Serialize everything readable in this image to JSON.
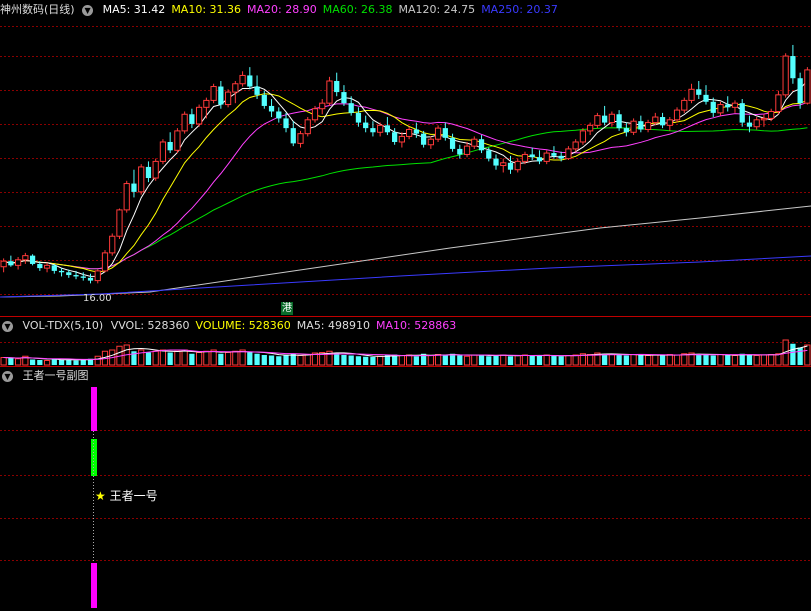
{
  "main": {
    "title": "神州数码(日线)",
    "ma": [
      {
        "label": "MA5: 31.42",
        "color": "#ffffff"
      },
      {
        "label": "MA10: 31.36",
        "color": "#ffff00"
      },
      {
        "label": "MA20: 28.90",
        "color": "#ff40ff"
      },
      {
        "label": "MA60: 26.38",
        "color": "#00e000"
      },
      {
        "label": "MA120: 24.75",
        "color": "#c8c8c8"
      },
      {
        "label": "MA250: 20.37",
        "color": "#3a3aff"
      }
    ],
    "low_label": "16.00",
    "hk_tag": "港"
  },
  "vol": {
    "title": "VOL-TDX(5,10)",
    "items": [
      {
        "label": "VVOL: 528360",
        "color": "#dddddd"
      },
      {
        "label": "VOLUME: 528360",
        "color": "#ffff00"
      },
      {
        "label": "MA5: 498910",
        "color": "#dddddd"
      },
      {
        "label": "MA10: 528863",
        "color": "#ff40ff"
      }
    ]
  },
  "sub": {
    "title": "王者一号副图",
    "signal_label": "王者一号",
    "star": "★"
  },
  "colors": {
    "up": "#ff3a3a",
    "down": "#54ffff",
    "grid": "#8a0000",
    "magenta": "#ff00ff",
    "green": "#00ff00"
  },
  "chart_data": {
    "type": "candlestick",
    "candles": [
      [
        17.2,
        17.8,
        16.8,
        17.6
      ],
      [
        17.6,
        18.0,
        17.2,
        17.3
      ],
      [
        17.3,
        17.9,
        17.0,
        17.7
      ],
      [
        17.7,
        18.2,
        17.4,
        18.0
      ],
      [
        18.0,
        18.1,
        17.3,
        17.4
      ],
      [
        17.4,
        17.6,
        16.9,
        17.1
      ],
      [
        17.1,
        17.5,
        16.8,
        17.3
      ],
      [
        17.3,
        17.4,
        16.7,
        16.9
      ],
      [
        16.9,
        17.1,
        16.5,
        16.8
      ],
      [
        16.8,
        17.0,
        16.4,
        16.6
      ],
      [
        16.6,
        16.9,
        16.3,
        16.5
      ],
      [
        16.5,
        16.8,
        16.2,
        16.4
      ],
      [
        16.4,
        16.7,
        16.0,
        16.2
      ],
      [
        16.2,
        17.0,
        16.0,
        16.9
      ],
      [
        16.9,
        18.4,
        16.8,
        18.2
      ],
      [
        18.2,
        19.6,
        18.0,
        19.4
      ],
      [
        19.4,
        21.4,
        19.2,
        21.3
      ],
      [
        21.3,
        23.4,
        21.1,
        23.2
      ],
      [
        23.2,
        24.2,
        22.2,
        22.6
      ],
      [
        22.6,
        24.6,
        22.4,
        24.4
      ],
      [
        24.4,
        24.8,
        23.3,
        23.6
      ],
      [
        23.6,
        25.0,
        23.4,
        24.8
      ],
      [
        24.8,
        26.4,
        24.6,
        26.2
      ],
      [
        26.2,
        26.9,
        25.4,
        25.6
      ],
      [
        25.6,
        27.2,
        25.4,
        27.0
      ],
      [
        27.0,
        28.4,
        26.8,
        28.2
      ],
      [
        28.2,
        28.6,
        27.2,
        27.5
      ],
      [
        27.5,
        28.9,
        27.3,
        28.7
      ],
      [
        28.7,
        29.4,
        27.9,
        29.2
      ],
      [
        29.2,
        30.4,
        29.0,
        30.2
      ],
      [
        30.2,
        30.6,
        28.6,
        28.9
      ],
      [
        28.9,
        30.0,
        28.7,
        29.8
      ],
      [
        29.8,
        30.6,
        29.0,
        30.4
      ],
      [
        30.4,
        31.3,
        30.2,
        31.0
      ],
      [
        31.0,
        31.6,
        30.0,
        30.2
      ],
      [
        30.2,
        31.0,
        29.3,
        29.6
      ],
      [
        29.6,
        29.9,
        28.6,
        28.8
      ],
      [
        28.8,
        29.3,
        28.0,
        28.4
      ],
      [
        28.4,
        28.7,
        27.6,
        27.9
      ],
      [
        27.9,
        28.3,
        26.9,
        27.2
      ],
      [
        27.2,
        27.7,
        25.9,
        26.1
      ],
      [
        26.1,
        27.0,
        25.8,
        26.8
      ],
      [
        26.8,
        28.0,
        26.6,
        27.8
      ],
      [
        27.8,
        28.8,
        27.6,
        28.6
      ],
      [
        28.6,
        29.3,
        28.2,
        29.0
      ],
      [
        29.0,
        30.9,
        28.8,
        30.6
      ],
      [
        30.6,
        31.2,
        29.5,
        29.8
      ],
      [
        29.8,
        30.3,
        28.8,
        29.0
      ],
      [
        29.0,
        29.5,
        28.1,
        28.3
      ],
      [
        28.3,
        28.7,
        27.3,
        27.6
      ],
      [
        27.6,
        28.1,
        26.9,
        27.2
      ],
      [
        27.2,
        27.7,
        26.6,
        26.9
      ],
      [
        26.9,
        27.6,
        26.6,
        27.4
      ],
      [
        27.4,
        28.0,
        26.7,
        26.9
      ],
      [
        26.9,
        27.2,
        26.0,
        26.2
      ],
      [
        26.2,
        26.9,
        25.8,
        26.6
      ],
      [
        26.6,
        27.3,
        26.4,
        27.1
      ],
      [
        27.1,
        27.6,
        26.5,
        26.8
      ],
      [
        26.8,
        27.0,
        25.8,
        26.0
      ],
      [
        26.0,
        26.6,
        25.7,
        26.4
      ],
      [
        26.4,
        27.4,
        26.2,
        27.2
      ],
      [
        27.2,
        27.6,
        26.3,
        26.5
      ],
      [
        26.5,
        26.8,
        25.5,
        25.7
      ],
      [
        25.7,
        26.0,
        25.0,
        25.3
      ],
      [
        25.3,
        26.2,
        25.1,
        25.9
      ],
      [
        25.9,
        26.6,
        25.7,
        26.4
      ],
      [
        26.4,
        26.7,
        25.4,
        25.6
      ],
      [
        25.6,
        25.8,
        24.8,
        25.0
      ],
      [
        25.0,
        25.3,
        24.2,
        24.5
      ],
      [
        24.5,
        25.0,
        24.0,
        24.7
      ],
      [
        24.7,
        25.2,
        23.9,
        24.2
      ],
      [
        24.2,
        25.0,
        24.0,
        24.8
      ],
      [
        24.8,
        25.5,
        24.6,
        25.3
      ],
      [
        25.3,
        25.8,
        24.9,
        25.1
      ],
      [
        25.1,
        25.6,
        24.6,
        24.8
      ],
      [
        24.8,
        25.6,
        24.6,
        25.4
      ],
      [
        25.4,
        25.9,
        25.0,
        25.2
      ],
      [
        25.2,
        25.5,
        24.8,
        25.0
      ],
      [
        25.0,
        25.9,
        24.9,
        25.7
      ],
      [
        25.7,
        26.4,
        25.5,
        26.2
      ],
      [
        26.2,
        27.2,
        26.0,
        27.0
      ],
      [
        27.0,
        27.6,
        26.7,
        27.4
      ],
      [
        27.4,
        28.3,
        27.2,
        28.1
      ],
      [
        28.1,
        28.8,
        27.4,
        27.6
      ],
      [
        27.6,
        28.4,
        27.3,
        28.2
      ],
      [
        28.2,
        28.5,
        27.0,
        27.2
      ],
      [
        27.2,
        27.6,
        26.6,
        26.9
      ],
      [
        26.9,
        27.9,
        26.7,
        27.7
      ],
      [
        27.7,
        28.1,
        26.9,
        27.1
      ],
      [
        27.1,
        27.8,
        26.9,
        27.6
      ],
      [
        27.6,
        28.3,
        27.4,
        28.0
      ],
      [
        28.0,
        28.3,
        27.2,
        27.4
      ],
      [
        27.4,
        28.0,
        27.0,
        27.8
      ],
      [
        27.8,
        28.7,
        27.6,
        28.5
      ],
      [
        28.5,
        29.4,
        28.3,
        29.2
      ],
      [
        29.2,
        30.4,
        29.0,
        30.0
      ],
      [
        30.0,
        30.6,
        29.3,
        29.6
      ],
      [
        29.6,
        30.3,
        28.9,
        29.1
      ],
      [
        29.1,
        29.4,
        28.0,
        28.3
      ],
      [
        28.3,
        29.1,
        28.1,
        28.9
      ],
      [
        28.9,
        29.5,
        28.4,
        28.7
      ],
      [
        28.7,
        29.2,
        28.3,
        29.0
      ],
      [
        29.0,
        29.3,
        27.3,
        27.6
      ],
      [
        27.6,
        28.1,
        26.9,
        27.3
      ],
      [
        27.3,
        28.0,
        27.1,
        27.8
      ],
      [
        27.8,
        28.2,
        27.3,
        27.9
      ],
      [
        27.9,
        28.6,
        27.7,
        28.4
      ],
      [
        28.4,
        29.9,
        28.2,
        29.6
      ],
      [
        29.6,
        32.6,
        29.4,
        32.4
      ],
      [
        32.4,
        33.2,
        30.4,
        30.8
      ],
      [
        30.8,
        31.2,
        28.6,
        29.0
      ],
      [
        29.0,
        31.6,
        28.9,
        31.4
      ]
    ],
    "volume_pct": [
      0.3,
      0.28,
      0.25,
      0.35,
      0.22,
      0.2,
      0.18,
      0.25,
      0.2,
      0.22,
      0.18,
      0.2,
      0.25,
      0.35,
      0.55,
      0.6,
      0.75,
      0.8,
      0.55,
      0.6,
      0.5,
      0.55,
      0.6,
      0.5,
      0.55,
      0.6,
      0.45,
      0.5,
      0.55,
      0.6,
      0.45,
      0.5,
      0.55,
      0.6,
      0.5,
      0.45,
      0.4,
      0.38,
      0.35,
      0.4,
      0.45,
      0.38,
      0.42,
      0.48,
      0.5,
      0.55,
      0.48,
      0.4,
      0.38,
      0.35,
      0.33,
      0.32,
      0.35,
      0.4,
      0.42,
      0.38,
      0.4,
      0.35,
      0.45,
      0.38,
      0.42,
      0.4,
      0.45,
      0.38,
      0.35,
      0.4,
      0.42,
      0.35,
      0.38,
      0.4,
      0.35,
      0.38,
      0.4,
      0.36,
      0.38,
      0.4,
      0.36,
      0.35,
      0.38,
      0.4,
      0.45,
      0.42,
      0.48,
      0.45,
      0.42,
      0.4,
      0.38,
      0.42,
      0.4,
      0.38,
      0.4,
      0.38,
      0.42,
      0.4,
      0.45,
      0.48,
      0.42,
      0.4,
      0.38,
      0.42,
      0.4,
      0.38,
      0.45,
      0.4,
      0.38,
      0.4,
      0.42,
      0.45,
      1.0,
      0.85,
      0.7,
      0.8
    ]
  }
}
